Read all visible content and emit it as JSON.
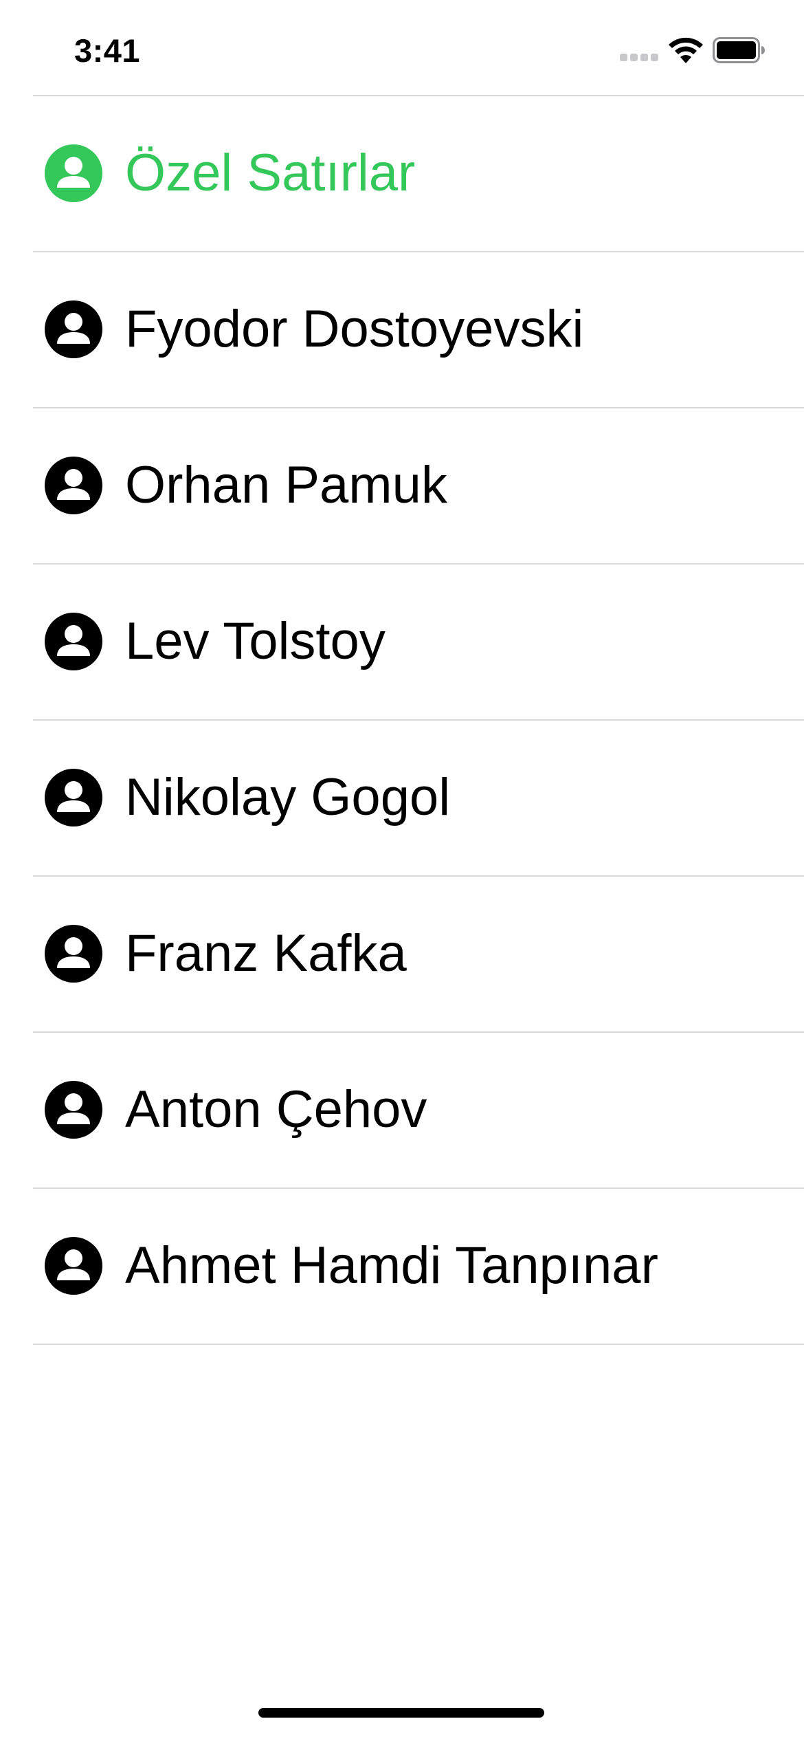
{
  "status_bar": {
    "time": "3:41",
    "signal_icon": "cellular-signal-icon",
    "wifi_icon": "wifi-icon",
    "battery_icon": "battery-full-icon"
  },
  "colors": {
    "accent": "#34c759",
    "text": "#000000",
    "separator": "#dadade"
  },
  "list": {
    "items": [
      {
        "label": "Özel Satırlar",
        "icon": "person-circle-icon",
        "highlight": true
      },
      {
        "label": "Fyodor Dostoyevski",
        "icon": "person-circle-icon",
        "highlight": false
      },
      {
        "label": "Orhan Pamuk",
        "icon": "person-circle-icon",
        "highlight": false
      },
      {
        "label": "Lev Tolstoy",
        "icon": "person-circle-icon",
        "highlight": false
      },
      {
        "label": "Nikolay Gogol",
        "icon": "person-circle-icon",
        "highlight": false
      },
      {
        "label": "Franz Kafka",
        "icon": "person-circle-icon",
        "highlight": false
      },
      {
        "label": "Anton Çehov",
        "icon": "person-circle-icon",
        "highlight": false
      },
      {
        "label": "Ahmet Hamdi Tanpınar",
        "icon": "person-circle-icon",
        "highlight": false
      }
    ]
  }
}
